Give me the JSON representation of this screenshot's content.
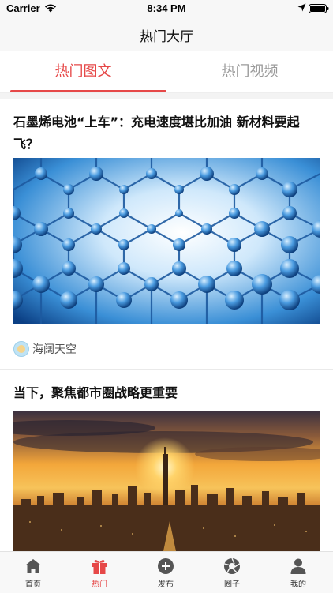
{
  "status_bar": {
    "carrier": "Carrier",
    "time": "8:34 PM"
  },
  "nav": {
    "title": "热门大厅"
  },
  "tabs": [
    {
      "label": "热门图文",
      "active": true
    },
    {
      "label": "热门视频",
      "active": false
    }
  ],
  "feed": [
    {
      "title": "石墨烯电池“上车”：充电速度堪比加油 新材料要起飞？",
      "image": "graphene-molecule-image",
      "author": "海阔天空"
    },
    {
      "title": "当下，聚焦都市圈战略更重要",
      "image": "city-sunset-image"
    }
  ],
  "tabbar": [
    {
      "label": "首页",
      "icon": "home-icon",
      "active": false
    },
    {
      "label": "热门",
      "icon": "gift-icon",
      "active": true
    },
    {
      "label": "发布",
      "icon": "add-circle-icon",
      "active": false
    },
    {
      "label": "圈子",
      "icon": "aperture-icon",
      "active": false
    },
    {
      "label": "我的",
      "icon": "user-icon",
      "active": false
    }
  ],
  "colors": {
    "accent": "#e64848",
    "inactive_tab": "#9a9a9a",
    "bar_bg": "#f7f7f7"
  }
}
